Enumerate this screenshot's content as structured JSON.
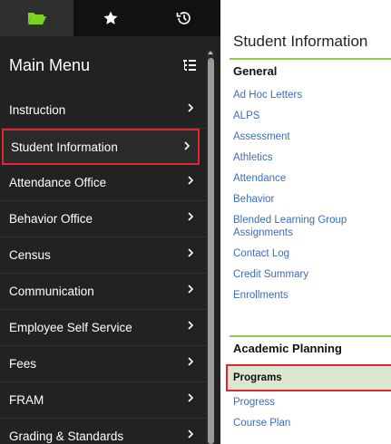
{
  "sidebar": {
    "tabs": [
      {
        "icon": "folder-open-icon",
        "color": "#7ed321"
      },
      {
        "icon": "star-icon"
      },
      {
        "icon": "history-icon"
      }
    ],
    "menu_title": "Main Menu",
    "items": [
      {
        "label": "Instruction"
      },
      {
        "label": "Student Information",
        "active": true
      },
      {
        "label": "Attendance Office"
      },
      {
        "label": "Behavior Office"
      },
      {
        "label": "Census"
      },
      {
        "label": "Communication"
      },
      {
        "label": "Employee Self Service"
      },
      {
        "label": "Fees"
      },
      {
        "label": "FRAM"
      },
      {
        "label": "Grading & Standards"
      }
    ]
  },
  "panel": {
    "title": "Student Information",
    "sections": [
      {
        "heading": "General",
        "links": [
          "Ad Hoc Letters",
          "ALPS",
          "Assessment",
          "Athletics",
          "Attendance",
          "Behavior",
          "Blended Learning Group Assignments",
          "Contact Log",
          "Credit Summary",
          "Enrollments"
        ]
      },
      {
        "heading": "Academic Planning",
        "selected": "Programs",
        "links": [
          "Progress",
          "Course Plan"
        ]
      }
    ]
  },
  "colors": {
    "accent_green": "#8fcf3e",
    "link_blue": "#3b6dbf",
    "highlight_red": "#e0262f",
    "selected_bg": "#dbe7cf",
    "sidebar_bg": "#222222"
  }
}
